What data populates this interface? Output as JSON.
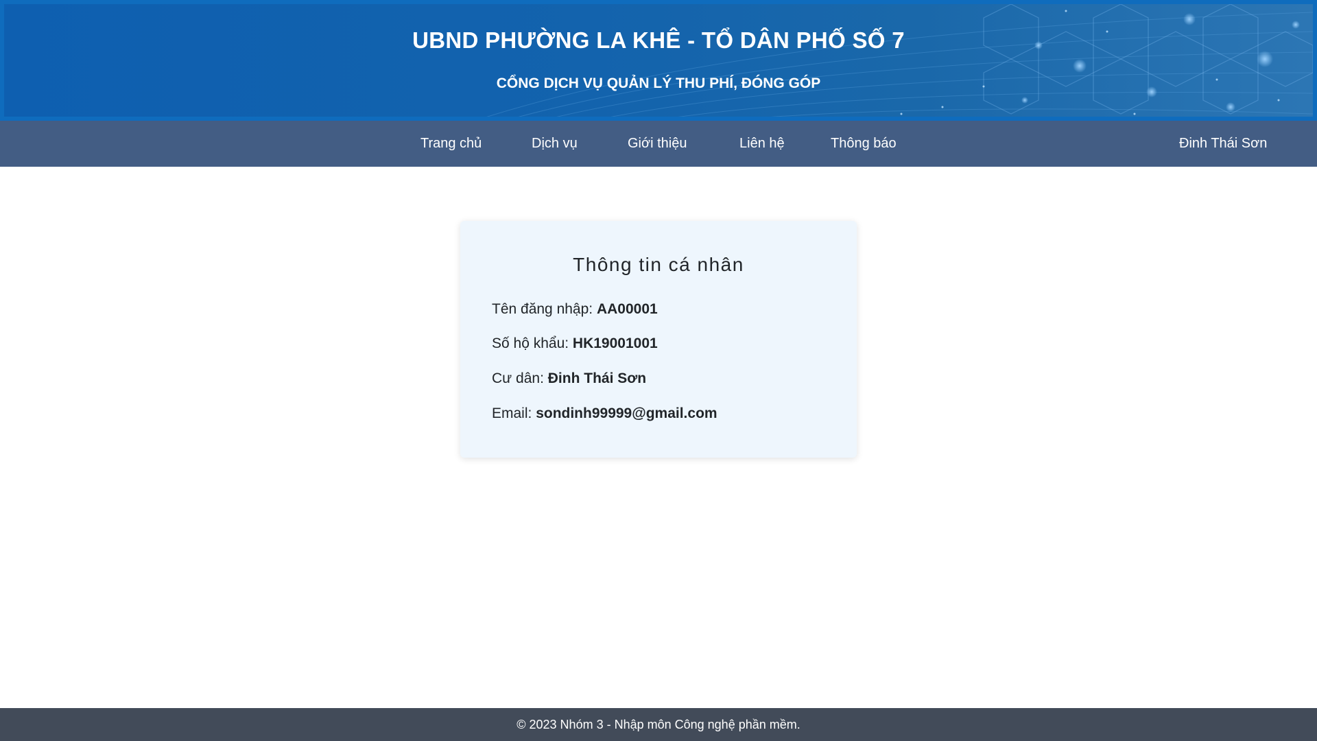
{
  "header": {
    "title": "UBND PHƯỜNG LA KHÊ - TỔ DÂN PHỐ SỐ 7",
    "subtitle": "CỔNG DỊCH VỤ QUẢN LÝ THU PHÍ, ĐÓNG GÓP"
  },
  "nav": {
    "items": [
      "Trang chủ",
      "Dịch vụ",
      "Giới thiệu",
      "Liên hệ",
      "Thông báo"
    ],
    "user": "Đinh Thái Sơn"
  },
  "profile": {
    "title": "Thông tin cá nhân",
    "fields": [
      {
        "label": "Tên đăng nhập:",
        "value": "AA00001"
      },
      {
        "label": "Số hộ khẩu:",
        "value": "HK19001001"
      },
      {
        "label": "Cư dân:",
        "value": "Đinh Thái Sơn"
      },
      {
        "label": "Email:",
        "value": "sondinh99999@gmail.com"
      }
    ]
  },
  "footer": {
    "text": "© 2023 Nhóm 3 - Nhập môn Công nghệ phần mềm."
  },
  "colors": {
    "banner_blue": "#1363ad",
    "nav_bg": "#435d84",
    "card_bg": "#eef6fd",
    "footer_bg": "#424b59"
  }
}
